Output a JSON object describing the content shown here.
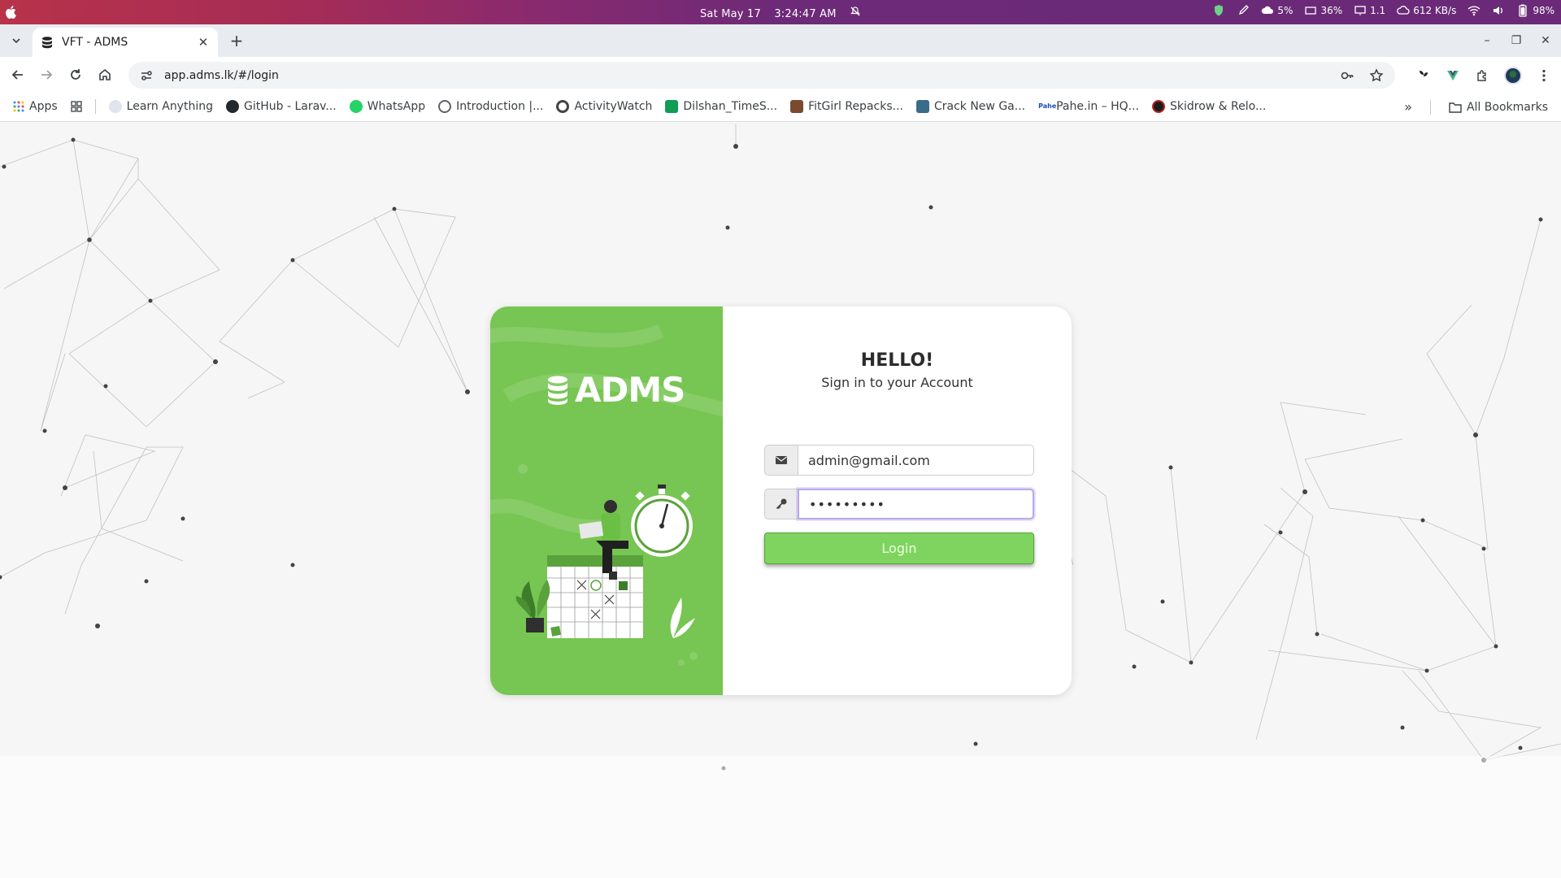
{
  "os_bar": {
    "date": "Sat May 17",
    "time": "3:24:47 AM",
    "tray": {
      "cpu": "5%",
      "memory": "36%",
      "load": "1.1",
      "network": "612 KB/s",
      "battery": "98%"
    }
  },
  "browser": {
    "tab": {
      "title": "VFT - ADMS"
    },
    "url": "app.adms.lk/#/login",
    "bookmarks": [
      {
        "label": "Apps",
        "icon": "apps-grid-icon"
      },
      {
        "label": "Learn Anything",
        "icon": "learn-anything-icon"
      },
      {
        "label": "GitHub - Larav...",
        "icon": "github-icon"
      },
      {
        "label": "WhatsApp",
        "icon": "whatsapp-icon"
      },
      {
        "label": "Introduction |...",
        "icon": "introduction-icon"
      },
      {
        "label": "ActivityWatch",
        "icon": "activitywatch-icon"
      },
      {
        "label": "Dilshan_TimeS...",
        "icon": "sheets-icon"
      },
      {
        "label": "FitGirl Repacks...",
        "icon": "fitgirl-icon"
      },
      {
        "label": "Crack New Ga...",
        "icon": "crack-icon"
      },
      {
        "label": "Pahe.in – HQ...",
        "icon": "pahe-icon"
      },
      {
        "label": "Skidrow & Relo...",
        "icon": "skidrow-icon"
      }
    ],
    "all_bookmarks": "All Bookmarks"
  },
  "login": {
    "brand": "ADMS",
    "heading": "HELLO!",
    "subheading": "Sign in to your Account",
    "email_value": "admin@gmail.com",
    "password_value": "•••••••••",
    "button_label": "Login"
  },
  "colors": {
    "brand_green": "#77c552",
    "button_green": "#7fd45f",
    "os_bar_gradient_start": "#b8324a",
    "os_bar_gradient_end": "#6a2a78"
  }
}
